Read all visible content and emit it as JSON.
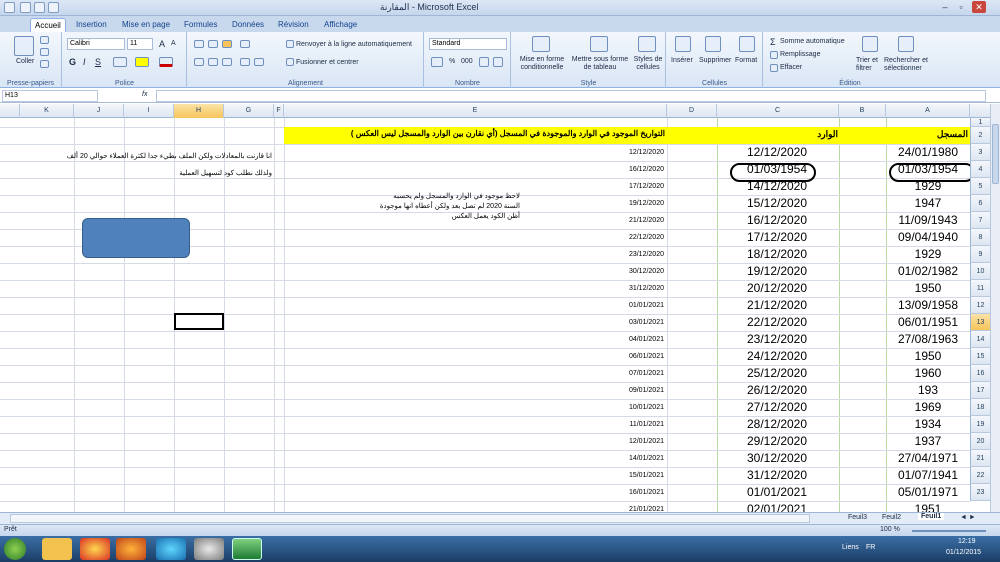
{
  "window": {
    "title": "المقارنة - Microsoft Excel",
    "minimize": "–",
    "restore": "▫",
    "close": "✕"
  },
  "tabs": [
    {
      "label": "Accueil"
    },
    {
      "label": "Insertion"
    },
    {
      "label": "Mise en page"
    },
    {
      "label": "Formules"
    },
    {
      "label": "Données"
    },
    {
      "label": "Révision"
    },
    {
      "label": "Affichage"
    }
  ],
  "ribbon": {
    "clipboard": {
      "paste": "Coller",
      "label": "Presse-papiers"
    },
    "font": {
      "name": "Calibri",
      "size": "11",
      "label": "Police",
      "bold": "G",
      "italic": "I",
      "underline": "S",
      "grow": "A",
      "shrink": "A"
    },
    "alignment": {
      "wrap": "Renvoyer à la ligne automatiquement",
      "merge": "Fusionner et centrer",
      "label": "Alignement"
    },
    "number": {
      "format": "Standard",
      "label": "Nombre",
      "pct": "%",
      "thousands": "000"
    },
    "styles": {
      "conditional": "Mise en forme conditionnelle",
      "table": "Mettre sous forme de tableau",
      "cell": "Styles de cellules",
      "label": "Style"
    },
    "cells": {
      "insert": "Insérer",
      "delete": "Supprimer",
      "format": "Format",
      "label": "Cellules"
    },
    "editing": {
      "sum": "Somme automatique",
      "fill": "Remplissage",
      "clear": "Effacer",
      "sort": "Trier et filtrer",
      "find": "Rechercher et sélectionner",
      "label": "Édition"
    }
  },
  "formula_bar": {
    "name_box": "H13",
    "fx": "fx",
    "value": ""
  },
  "columns": [
    "K",
    "J",
    "I",
    "H",
    "G",
    "F",
    "E",
    "D",
    "C",
    "B",
    "A"
  ],
  "rows": [
    "1",
    "2",
    "3",
    "4",
    "5",
    "6",
    "7",
    "8",
    "9",
    "10",
    "11",
    "12",
    "13",
    "14",
    "15",
    "16",
    "17",
    "18",
    "19",
    "20",
    "21",
    "22",
    "23"
  ],
  "headers": {
    "E2": "التواريخ الموجود في الوارد والموجودة في المسجل (أي نقارن بين الوارد والمسجل ليس العكس )",
    "C2": "الوارد",
    "A2": "المسجل"
  },
  "col_A": [
    "24/01/1980",
    "01/03/1954",
    "1929",
    "1947",
    "11/09/1943",
    "09/04/1940",
    "1929",
    "01/02/1982",
    "1950",
    "13/09/1958",
    "06/01/1951",
    "27/08/1963",
    "1950",
    "1960",
    "193",
    "1969",
    "1934",
    "1937",
    "27/04/1971",
    "01/07/1941",
    "05/01/1971",
    "1951"
  ],
  "col_C": [
    "12/12/2020",
    "01/03/1954",
    "14/12/2020",
    "15/12/2020",
    "16/12/2020",
    "17/12/2020",
    "18/12/2020",
    "19/12/2020",
    "20/12/2020",
    "21/12/2020",
    "22/12/2020",
    "23/12/2020",
    "24/12/2020",
    "25/12/2020",
    "26/12/2020",
    "27/12/2020",
    "28/12/2020",
    "29/12/2020",
    "30/12/2020",
    "31/12/2020",
    "01/01/2021",
    "02/01/2021"
  ],
  "col_D": [
    "12/12/2020",
    "16/12/2020",
    "17/12/2020",
    "19/12/2020",
    "21/12/2020",
    "22/12/2020",
    "23/12/2020",
    "30/12/2020",
    "31/12/2020",
    "01/01/2021",
    "03/01/2021",
    "04/01/2021",
    "06/01/2021",
    "07/01/2021",
    "09/01/2021",
    "10/01/2021",
    "11/01/2021",
    "12/01/2021",
    "14/01/2021",
    "15/01/2021",
    "16/01/2021",
    "21/01/2021"
  ],
  "notes": {
    "note_e": [
      "لاحظ موجود في الوارد والمسجل ولم يحسبه",
      "السنة 2020 لم تصل بعد ولكن أعطاه انها موجودة",
      "أظن الكود يعمل العكس"
    ],
    "note_j": [
      "انا قارنت بالمعادلات ولكن الملف بطيء جدا لكثرة العملاء حوالي 20 ألف",
      "ولذلك نطلب كود  لتسهيل العملية"
    ]
  },
  "sheets": {
    "tabs": [
      "Feuil3",
      "Feuil2",
      "Feuil1"
    ],
    "nav": "◄ ►"
  },
  "status": {
    "ready": "Prêt",
    "zoom": "100 %"
  },
  "taskbar": {
    "lang": "FR",
    "links": "Liens",
    "time": "12:19",
    "date": "01/12/2015"
  },
  "colors": {
    "header_fill": "#ffff00",
    "shape_fill": "#4f81bd",
    "sheet_tab": "#ffffff"
  }
}
